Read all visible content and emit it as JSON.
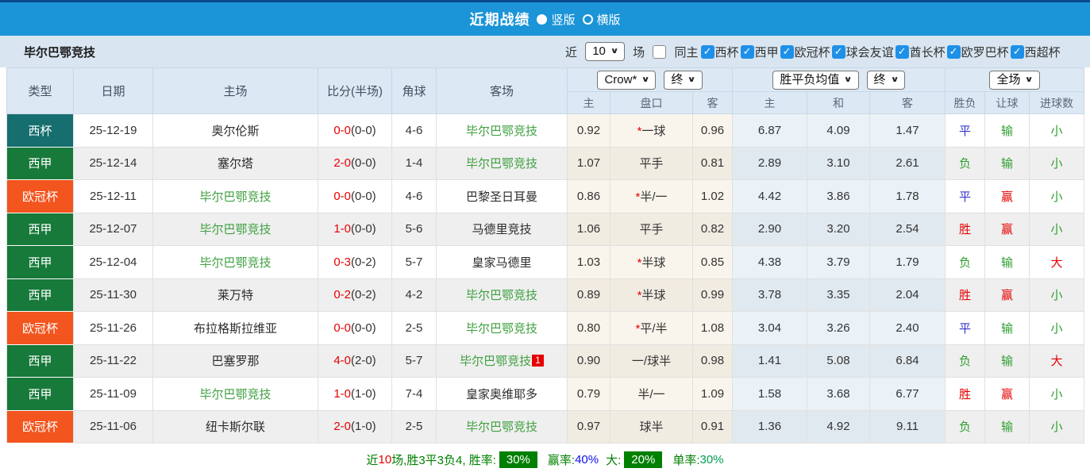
{
  "topbar": {
    "title": "近期战绩",
    "vertical_label": "竖版",
    "horizontal_label": "横版"
  },
  "filter": {
    "team": "毕尔巴鄂竞技",
    "near_label": "近",
    "count_value": "10",
    "games_label": "场",
    "same_home_label": "同主",
    "leagues": [
      "西杯",
      "西甲",
      "欧冠杯",
      "球会友谊",
      "酋长杯",
      "欧罗巴杯",
      "西超杯"
    ]
  },
  "header": {
    "type": "类型",
    "date": "日期",
    "home": "主场",
    "score": "比分(半场)",
    "corner": "角球",
    "away": "客场",
    "book_select": "Crow*",
    "book_stage_select": "终",
    "avg_select": "胜平负均值",
    "avg_stage_select": "终",
    "scope_select": "全场",
    "sub_home": "主",
    "sub_handicap": "盘口",
    "sub_away": "客",
    "sub_avg_home": "主",
    "sub_avg_draw": "和",
    "sub_avg_away": "客",
    "sub_result": "胜负",
    "sub_handicap_result": "让球",
    "sub_goals": "进球数"
  },
  "rows": [
    {
      "type": "西杯",
      "type_class": "cup",
      "date": "25-12-19",
      "home": "奥尔伦斯",
      "home_green": false,
      "score_ft": "0-0",
      "score_ht": "(0-0)",
      "corner": "4-6",
      "away": "毕尔巴鄂竞技",
      "away_green": true,
      "away_badge": "",
      "odds_home": "0.92",
      "handicap_star": "*",
      "handicap_line": "一球",
      "odds_away": "0.96",
      "avg_home": "6.87",
      "avg_draw": "4.09",
      "avg_away": "1.47",
      "result": "平",
      "result_class": "blue",
      "handicap_result": "输",
      "handicap_class": "green",
      "goals": "小",
      "goals_class": "green"
    },
    {
      "type": "西甲",
      "type_class": "liga",
      "date": "25-12-14",
      "home": "塞尔塔",
      "home_green": false,
      "score_ft": "2-0",
      "score_ht": "(0-0)",
      "corner": "1-4",
      "away": "毕尔巴鄂竞技",
      "away_green": true,
      "away_badge": "",
      "odds_home": "1.07",
      "handicap_star": "",
      "handicap_line": "平手",
      "odds_away": "0.81",
      "avg_home": "2.89",
      "avg_draw": "3.10",
      "avg_away": "2.61",
      "result": "负",
      "result_class": "green",
      "handicap_result": "输",
      "handicap_class": "green",
      "goals": "小",
      "goals_class": "green"
    },
    {
      "type": "欧冠杯",
      "type_class": "ucl",
      "date": "25-12-11",
      "home": "毕尔巴鄂竞技",
      "home_green": true,
      "score_ft": "0-0",
      "score_ht": "(0-0)",
      "corner": "4-6",
      "away": "巴黎圣日耳曼",
      "away_green": false,
      "away_badge": "",
      "odds_home": "0.86",
      "handicap_star": "*",
      "handicap_line": "半/一",
      "odds_away": "1.02",
      "avg_home": "4.42",
      "avg_draw": "3.86",
      "avg_away": "1.78",
      "result": "平",
      "result_class": "blue",
      "handicap_result": "赢",
      "handicap_class": "red",
      "goals": "小",
      "goals_class": "green"
    },
    {
      "type": "西甲",
      "type_class": "liga",
      "date": "25-12-07",
      "home": "毕尔巴鄂竞技",
      "home_green": true,
      "score_ft": "1-0",
      "score_ht": "(0-0)",
      "corner": "5-6",
      "away": "马德里竞技",
      "away_green": false,
      "away_badge": "",
      "odds_home": "1.06",
      "handicap_star": "",
      "handicap_line": "平手",
      "odds_away": "0.82",
      "avg_home": "2.90",
      "avg_draw": "3.20",
      "avg_away": "2.54",
      "result": "胜",
      "result_class": "red",
      "handicap_result": "赢",
      "handicap_class": "red",
      "goals": "小",
      "goals_class": "green"
    },
    {
      "type": "西甲",
      "type_class": "liga",
      "date": "25-12-04",
      "home": "毕尔巴鄂竞技",
      "home_green": true,
      "score_ft": "0-3",
      "score_ht": "(0-2)",
      "corner": "5-7",
      "away": "皇家马德里",
      "away_green": false,
      "away_badge": "",
      "odds_home": "1.03",
      "handicap_star": "*",
      "handicap_line": "半球",
      "odds_away": "0.85",
      "avg_home": "4.38",
      "avg_draw": "3.79",
      "avg_away": "1.79",
      "result": "负",
      "result_class": "green",
      "handicap_result": "输",
      "handicap_class": "green",
      "goals": "大",
      "goals_class": "red"
    },
    {
      "type": "西甲",
      "type_class": "liga",
      "date": "25-11-30",
      "home": "莱万特",
      "home_green": false,
      "score_ft": "0-2",
      "score_ht": "(0-2)",
      "corner": "4-2",
      "away": "毕尔巴鄂竞技",
      "away_green": true,
      "away_badge": "",
      "odds_home": "0.89",
      "handicap_star": "*",
      "handicap_line": "半球",
      "odds_away": "0.99",
      "avg_home": "3.78",
      "avg_draw": "3.35",
      "avg_away": "2.04",
      "result": "胜",
      "result_class": "red",
      "handicap_result": "赢",
      "handicap_class": "red",
      "goals": "小",
      "goals_class": "green"
    },
    {
      "type": "欧冠杯",
      "type_class": "ucl",
      "date": "25-11-26",
      "home": "布拉格斯拉维亚",
      "home_green": false,
      "score_ft": "0-0",
      "score_ht": "(0-0)",
      "corner": "2-5",
      "away": "毕尔巴鄂竞技",
      "away_green": true,
      "away_badge": "",
      "odds_home": "0.80",
      "handicap_star": "*",
      "handicap_line": "平/半",
      "odds_away": "1.08",
      "avg_home": "3.04",
      "avg_draw": "3.26",
      "avg_away": "2.40",
      "result": "平",
      "result_class": "blue",
      "handicap_result": "输",
      "handicap_class": "green",
      "goals": "小",
      "goals_class": "green"
    },
    {
      "type": "西甲",
      "type_class": "liga",
      "date": "25-11-22",
      "home": "巴塞罗那",
      "home_green": false,
      "score_ft": "4-0",
      "score_ht": "(2-0)",
      "corner": "5-7",
      "away": "毕尔巴鄂竞技",
      "away_green": true,
      "away_badge": "1",
      "odds_home": "0.90",
      "handicap_star": "",
      "handicap_line": "一/球半",
      "odds_away": "0.98",
      "avg_home": "1.41",
      "avg_draw": "5.08",
      "avg_away": "6.84",
      "result": "负",
      "result_class": "green",
      "handicap_result": "输",
      "handicap_class": "green",
      "goals": "大",
      "goals_class": "red"
    },
    {
      "type": "西甲",
      "type_class": "liga",
      "date": "25-11-09",
      "home": "毕尔巴鄂竞技",
      "home_green": true,
      "score_ft": "1-0",
      "score_ht": "(1-0)",
      "corner": "7-4",
      "away": "皇家奥维耶多",
      "away_green": false,
      "away_badge": "",
      "odds_home": "0.79",
      "handicap_star": "",
      "handicap_line": "半/一",
      "odds_away": "1.09",
      "avg_home": "1.58",
      "avg_draw": "3.68",
      "avg_away": "6.77",
      "result": "胜",
      "result_class": "red",
      "handicap_result": "赢",
      "handicap_class": "red",
      "goals": "小",
      "goals_class": "green"
    },
    {
      "type": "欧冠杯",
      "type_class": "ucl",
      "date": "25-11-06",
      "home": "纽卡斯尔联",
      "home_green": false,
      "score_ft": "2-0",
      "score_ht": "(1-0)",
      "corner": "2-5",
      "away": "毕尔巴鄂竞技",
      "away_green": true,
      "away_badge": "",
      "odds_home": "0.97",
      "handicap_star": "",
      "handicap_line": "球半",
      "odds_away": "0.91",
      "avg_home": "1.36",
      "avg_draw": "4.92",
      "avg_away": "9.11",
      "result": "负",
      "result_class": "green",
      "handicap_result": "输",
      "handicap_class": "green",
      "goals": "小",
      "goals_class": "green"
    }
  ],
  "footer": {
    "near_label": "近",
    "near_count": "10",
    "record": "场,胜3平3负4, 胜率:",
    "win_rate": "30%",
    "handicap_label": "赢率:",
    "handicap_rate": "40%",
    "big_label": "大:",
    "big_rate": "20%",
    "single_label": "单率:",
    "single_rate": "30%"
  },
  "colors": {
    "topbar_blue": "#1b94d8",
    "league_cup_teal": "#166e6e",
    "league_liga_green": "#17793a",
    "league_ucl_orange": "#f2551e",
    "team_link_green": "#3fa040",
    "score_red": "#e60000",
    "draw_blue": "#3333cc",
    "lose_green": "#2f9e2f",
    "summary_badge_green": "#008000"
  }
}
